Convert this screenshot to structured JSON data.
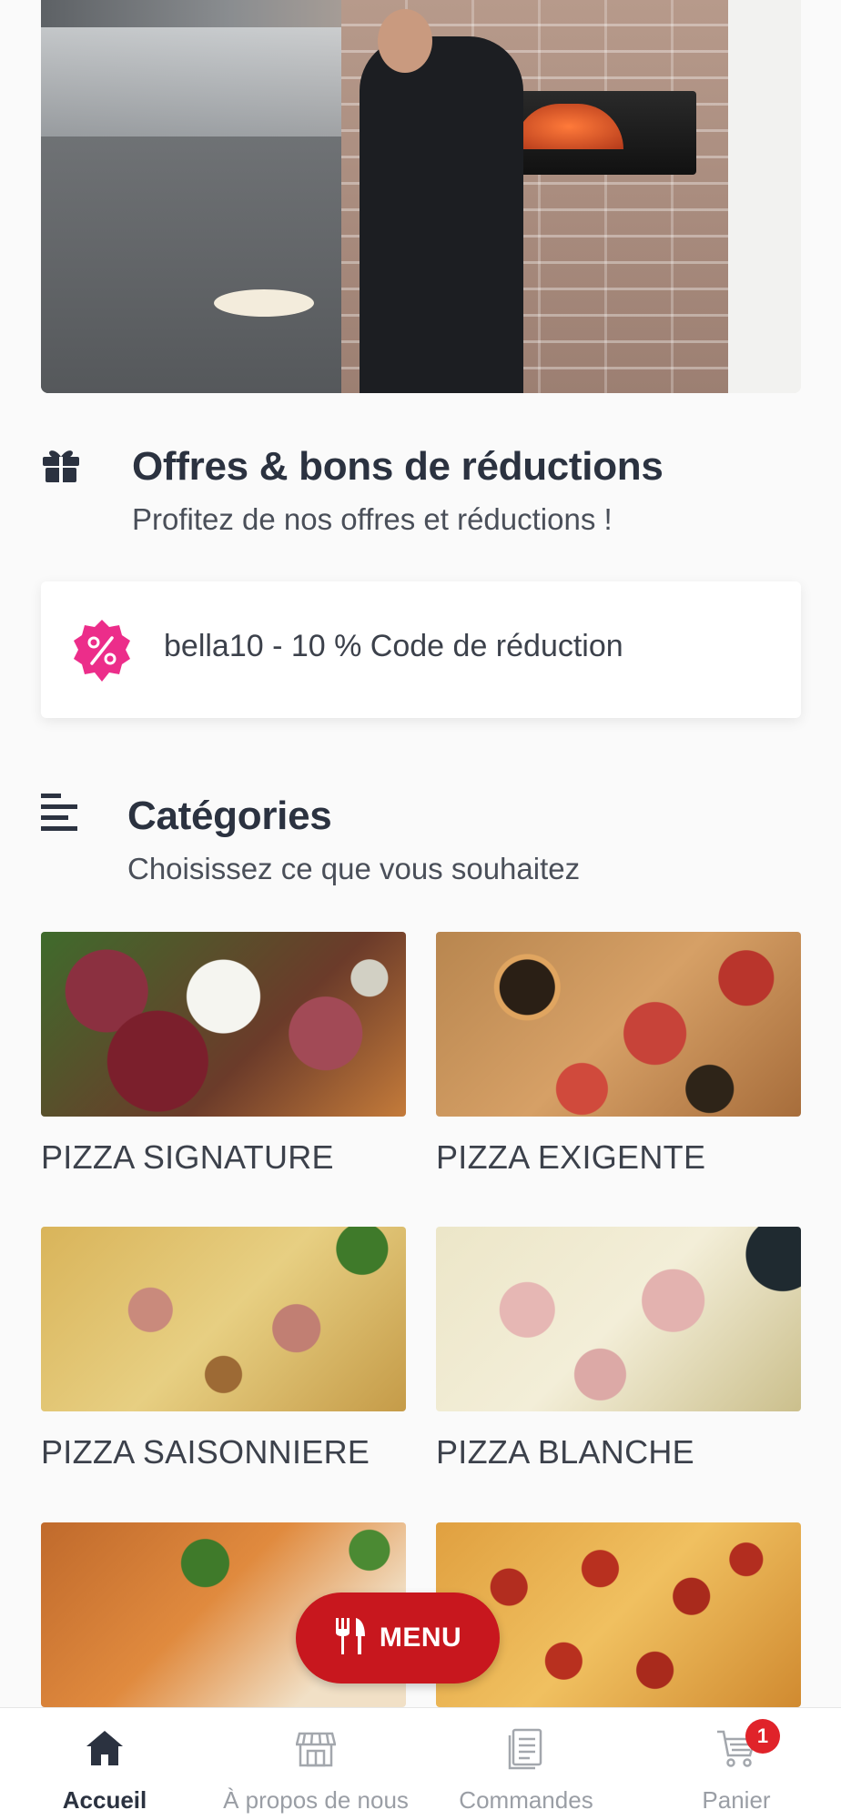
{
  "offers": {
    "title": "Offres & bons de réductions",
    "subtitle": "Profitez de nos offres et réductions !",
    "coupon_text": "bella10 - 10 % Code de réduction"
  },
  "categories_section": {
    "title": "Catégories",
    "subtitle": "Choisissez ce que vous souhaitez",
    "items": [
      {
        "label": "PIZZA SIGNATURE"
      },
      {
        "label": "PIZZA EXIGENTE"
      },
      {
        "label": "PIZZA SAISONNIERE"
      },
      {
        "label": "PIZZA BLANCHE"
      },
      {
        "label": ""
      },
      {
        "label": ""
      }
    ]
  },
  "menu_button": {
    "label": "MENU",
    "icon": "fork-knife-icon"
  },
  "tabbar": {
    "tabs": [
      {
        "label": "Accueil",
        "icon": "home-icon",
        "active": true
      },
      {
        "label": "À propos de nous",
        "icon": "store-icon",
        "active": false
      },
      {
        "label": "Commandes",
        "icon": "orders-icon",
        "active": false
      },
      {
        "label": "Panier",
        "icon": "cart-icon",
        "active": false,
        "badge": "1"
      }
    ]
  },
  "colors": {
    "accent": "#c8171e",
    "badge_pink": "#ec2d8a",
    "text_dark": "#2b3240"
  }
}
